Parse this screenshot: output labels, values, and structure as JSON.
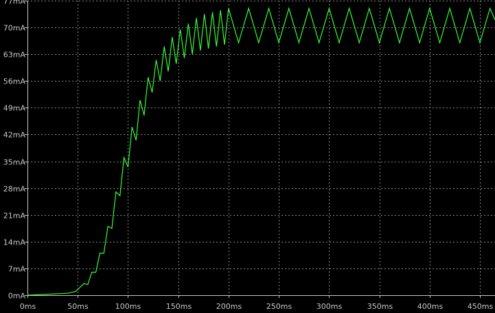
{
  "chart_data": {
    "type": "line",
    "title": "",
    "xlabel": "",
    "ylabel": "",
    "background": "#000000",
    "grid": true,
    "xlim": [
      0,
      465
    ],
    "ylim": [
      0,
      77
    ],
    "x_ticks": [
      0,
      50,
      100,
      150,
      200,
      250,
      300,
      350,
      400,
      450
    ],
    "x_tick_labels": [
      "0ms",
      "50ms",
      "100ms",
      "150ms",
      "200ms",
      "250ms",
      "300ms",
      "350ms",
      "400ms",
      "450ms"
    ],
    "y_ticks": [
      0,
      7,
      14,
      21,
      28,
      35,
      42,
      49,
      56,
      63,
      70,
      77
    ],
    "y_tick_labels": [
      "0mA",
      "7mA",
      "14mA",
      "21mA",
      "28mA",
      "35mA",
      "42mA",
      "49mA",
      "56mA",
      "63mA",
      "70mA",
      "77mA"
    ],
    "series": [
      {
        "color": "#33ff33",
        "x_unit": "ms",
        "y_unit": "mA",
        "x": [
          0,
          40,
          48,
          52,
          56,
          60,
          64,
          68,
          72,
          76,
          80,
          84,
          88,
          92,
          96,
          100,
          104,
          108,
          112,
          116,
          120,
          124,
          128,
          132,
          136,
          140,
          144,
          148,
          152,
          156,
          160,
          164,
          168,
          172,
          176,
          180,
          184,
          188,
          192,
          196,
          200,
          210,
          220,
          230,
          240,
          250,
          260,
          270,
          280,
          290,
          300,
          310,
          320,
          330,
          340,
          350,
          360,
          370,
          380,
          390,
          400,
          410,
          420,
          430,
          440,
          450,
          460,
          465
        ],
        "y": [
          0,
          0.5,
          1,
          2,
          3,
          2.8,
          6,
          6,
          11,
          11,
          18,
          17.5,
          27,
          26,
          36,
          33.5,
          44,
          40.5,
          51,
          47,
          57,
          53,
          61.5,
          56,
          65,
          58.5,
          67.5,
          60.5,
          69.5,
          62,
          71,
          63,
          72.5,
          64,
          73.5,
          64.5,
          74,
          65,
          74.5,
          65.5,
          75,
          66,
          75,
          66,
          75,
          66,
          75,
          66,
          75,
          66,
          75,
          66,
          75,
          66,
          75,
          66,
          75,
          66,
          75,
          66,
          75,
          66,
          75,
          66,
          75,
          66,
          75,
          72
        ]
      }
    ]
  }
}
